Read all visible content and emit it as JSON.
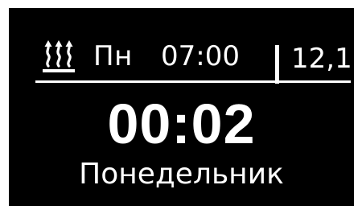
{
  "status_bar": {
    "heating_icon": "heating-waves-icon",
    "day_short": "Пн",
    "schedule_time": "07:00",
    "temperature": "12,1"
  },
  "main": {
    "clock": "00:02",
    "weekday": "Понедельник"
  },
  "colors": {
    "background": "#000000",
    "foreground": "#ffffff"
  }
}
